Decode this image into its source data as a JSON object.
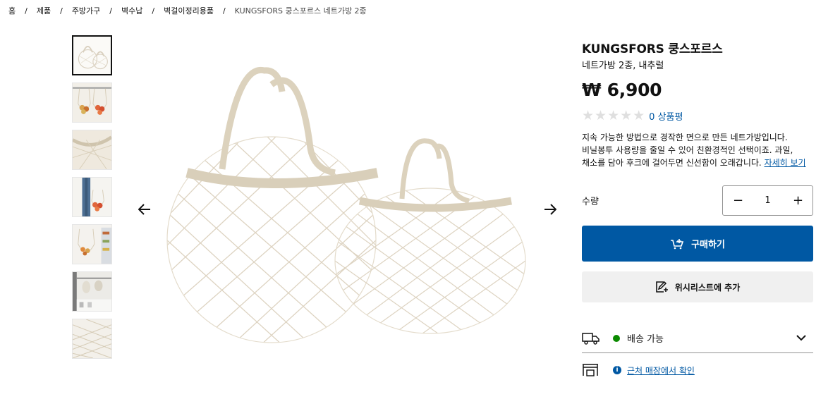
{
  "breadcrumb": {
    "items": [
      "홈",
      "제품",
      "주방가구",
      "벽수납",
      "벽걸이정리용품"
    ],
    "current": "KUNGSFORS 쿵스포르스 네트가방 2종",
    "separator": "/"
  },
  "thumbnails": [
    {
      "name": "bag-pair",
      "selected": true
    },
    {
      "name": "hanging-produce"
    },
    {
      "name": "net-closeup"
    },
    {
      "name": "person-carrying"
    },
    {
      "name": "kitchen-wall"
    },
    {
      "name": "rail-bags"
    },
    {
      "name": "net-pattern"
    }
  ],
  "product": {
    "name": "KUNGSFORS 쿵스포르스",
    "subtitle": "네트가방 2종, 내추럴",
    "price": "₩ 6,900",
    "rating_stars": "★★★★★",
    "rating_value": 0,
    "review_count_label": "0 상품평",
    "description_line1": "지속 가능한 방법으로 경작한 면으로 만든 네트가방입니다.",
    "description_line2": "비닐봉투 사용량을 줄일 수 있어 친환경적인 선택이죠. 과일,",
    "description_line3": "채소를 담아 후크에 걸어두면 신선함이 오래갑니다.",
    "more_link": "자세히 보기"
  },
  "quantity": {
    "label": "수량",
    "value": "1",
    "minus": "−",
    "plus": "+"
  },
  "actions": {
    "buy_label": "구매하기",
    "wishlist_label": "위시리스트에 추가"
  },
  "delivery": {
    "label": "배송 가능",
    "status_color": "#0a8a00"
  },
  "store": {
    "link_label": "근처 매장에서 확인",
    "info_glyph": "i"
  },
  "colors": {
    "brand_blue": "#0058a3",
    "secondary_bg": "#f0f0f0"
  },
  "icons": [
    "arrow-left-icon",
    "arrow-right-icon",
    "cart-add-icon",
    "wishlist-add-icon",
    "truck-icon",
    "chevron-down-icon",
    "store-icon",
    "info-icon"
  ]
}
